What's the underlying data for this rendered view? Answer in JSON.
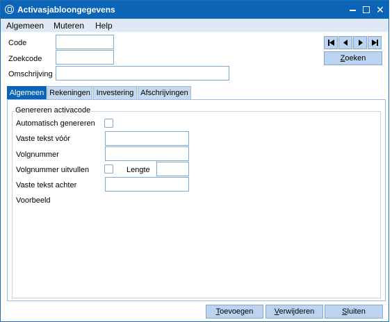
{
  "window": {
    "title": "Activasjabloongegevens",
    "icon": "app-circle-icon",
    "controls": {
      "minimize": "minimize-icon",
      "maximize": "maximize-icon",
      "close": "✕"
    }
  },
  "menu": {
    "items": [
      "Algemeen",
      "Muteren",
      "Help"
    ]
  },
  "header_fields": {
    "code": {
      "label": "Code",
      "value": ""
    },
    "zoekcode": {
      "label": "Zoekcode",
      "value": ""
    },
    "omschrijving": {
      "label": "Omschrijving",
      "value": ""
    }
  },
  "record_nav": {
    "icons": [
      "first-record-icon",
      "previous-record-icon",
      "next-record-icon",
      "last-record-icon"
    ]
  },
  "search_button": {
    "mnemonic": "Z",
    "rest": "oeken"
  },
  "tabs": [
    "Algemeen",
    "Rekeningen",
    "Investering",
    "Afschrijvingen"
  ],
  "active_tab": "Algemeen",
  "group": {
    "title": "Genereren activacode",
    "automatisch_genereren": {
      "label": "Automatisch genereren",
      "checked": false
    },
    "vaste_tekst_voor": {
      "label": "Vaste tekst vóór",
      "value": ""
    },
    "volgnummer": {
      "label": "Volgnummer",
      "value": ""
    },
    "volgnummer_uitvullen": {
      "label": "Volgnummer uitvullen",
      "checked": false
    },
    "lengte": {
      "label": "Lengte",
      "value": ""
    },
    "vaste_tekst_achter": {
      "label": "Vaste tekst achter",
      "value": ""
    },
    "voorbeeld": {
      "label": "Voorbeeld"
    }
  },
  "footer_buttons": {
    "toevoegen": {
      "mnemonic": "T",
      "rest": "oevoegen"
    },
    "verwijderen": {
      "mnemonic": "V",
      "rest": "erwijderen"
    },
    "sluiten": {
      "mnemonic": "S",
      "rest": "luiten"
    }
  },
  "colors": {
    "titlebar": "#0b64b6",
    "menubar": "#dfe9f5",
    "button": "#bcd4ef",
    "border": "#7fa7d4"
  }
}
